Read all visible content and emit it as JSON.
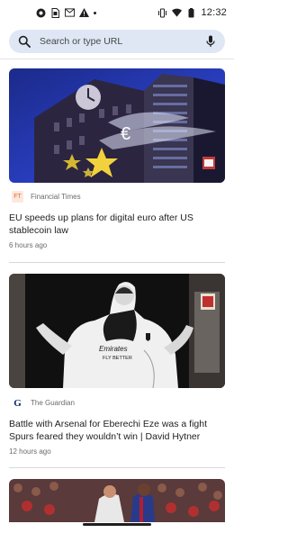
{
  "status_bar": {
    "time": "12:32",
    "left_icons": [
      "chrome-icon",
      "sim-icon",
      "gmail-icon",
      "warning-icon",
      "dot-icon"
    ],
    "right_icons": [
      "vibrate-icon",
      "wifi-icon",
      "battery-icon"
    ]
  },
  "search": {
    "placeholder": "Search or type URL"
  },
  "feed": [
    {
      "source": "Financial Times",
      "source_logo_text": "FT",
      "headline": "EU speeds up plans for digital euro after US stablecoin law",
      "time_ago": "6 hours ago",
      "image_sign_text": "€"
    },
    {
      "source": "The Guardian",
      "source_logo_text": "G",
      "headline": "Battle with Arsenal for Eberechi Eze was a fight Spurs feared they wouldn’t win | David Hytner",
      "time_ago": "12 hours ago",
      "image_shirt_text": "Emirates FLY BETTER"
    },
    {
      "source": "",
      "headline": "",
      "time_ago": ""
    }
  ],
  "colors": {
    "search_bg": "#dfe7f5",
    "ft_logo_bg": "#fce8dc",
    "ft_logo_fg": "#e06a3c",
    "guardian_logo_fg": "#0a2b63"
  }
}
